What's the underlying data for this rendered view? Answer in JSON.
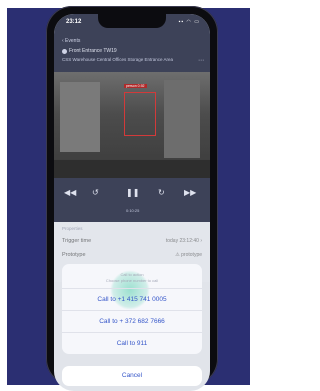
{
  "status": {
    "time": "23:12"
  },
  "header": {
    "back_label": "‹ Events",
    "camera_name": "Front Entrance TW19",
    "camera_location": "CSS Warehouse Central Offices Storage Entrance Area"
  },
  "video": {
    "detection_label": "person 0.92"
  },
  "player": {
    "timestamp": "0:10:25"
  },
  "details": {
    "section": "Properties",
    "rows": [
      {
        "label": "Trigger time",
        "value": "today 23:12:40 ›"
      },
      {
        "label": "Prototype",
        "value": "⚠ prototype"
      }
    ]
  },
  "sheet": {
    "title_line1": "Call to action",
    "title_line2": "Choose phone number to call",
    "options": [
      "Call to +1 415 741 0005",
      "Call to + 372 682 7666",
      "Call to 911"
    ],
    "cancel_label": "Cancel"
  }
}
